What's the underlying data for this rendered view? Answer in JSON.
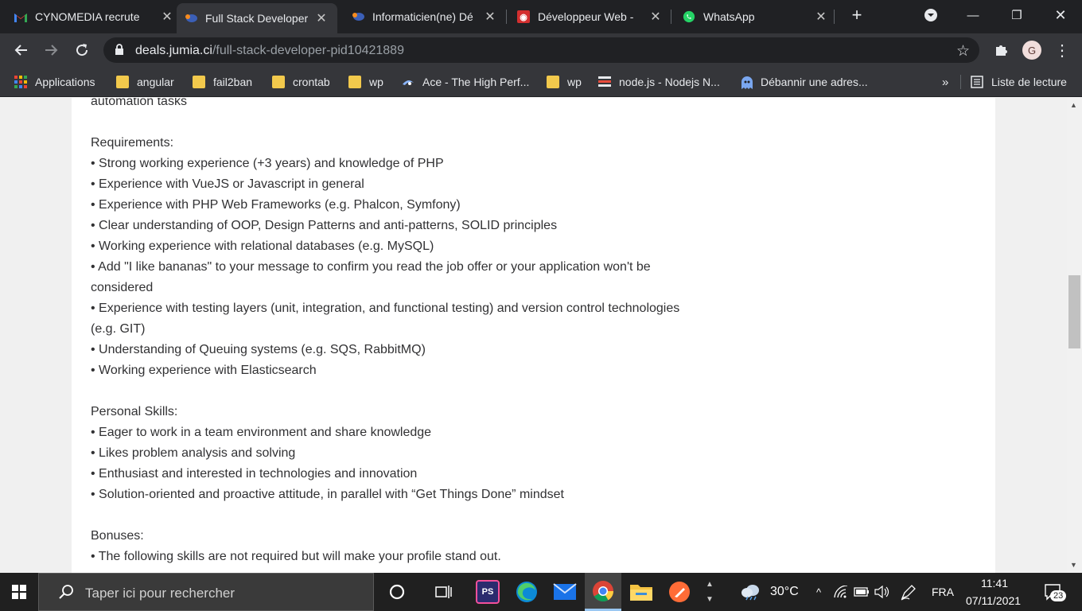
{
  "tabs": [
    {
      "title": "CYNOMEDIA recrute",
      "icon": "gmail-icon"
    },
    {
      "title": "Full Stack Developer",
      "icon": "jumia-icon"
    },
    {
      "title": "Informaticien(ne) Dé",
      "icon": "jumia-icon"
    },
    {
      "title": "Développeur Web - ",
      "icon": "emploi-icon"
    },
    {
      "title": "WhatsApp",
      "icon": "whatsapp-icon"
    }
  ],
  "address": {
    "host": "deals.jumia.ci",
    "path": "/full-stack-developer-pid10421889"
  },
  "profile_initial": "G",
  "bookmarks": [
    {
      "label": "Applications",
      "icon": "apps-grid-icon"
    },
    {
      "label": "angular",
      "icon": "folder-icon"
    },
    {
      "label": "fail2ban",
      "icon": "folder-icon"
    },
    {
      "label": "crontab",
      "icon": "folder-icon"
    },
    {
      "label": "wp",
      "icon": "folder-icon"
    },
    {
      "label": "Ace - The High Perf...",
      "icon": "ace-icon"
    },
    {
      "label": "wp",
      "icon": "folder-icon"
    },
    {
      "label": "node.js - Nodejs N...",
      "icon": "stackoverflow-icon"
    },
    {
      "label": "Débannir une adres...",
      "icon": "ghost-icon"
    }
  ],
  "bookmarks_overflow": "»",
  "reading_list": "Liste de lecture",
  "content": {
    "line_top": "automation tasks",
    "requirements_heading": "Requirements:",
    "requirements": [
      "• Strong working experience (+3 years) and knowledge of PHP",
      "• Experience with VueJS or Javascript in general",
      "• Experience with PHP Web Frameworks (e.g. Phalcon, Symfony)",
      "• Clear understanding of OOP, Design Patterns and anti-patterns, SOLID principles",
      "• Working experience with relational databases (e.g. MySQL)",
      "• Add \"I like bananas\" to your message to confirm you read the job offer or your application won't be considered",
      "• Experience with testing layers (unit, integration, and functional testing) and version control technologies (e.g. GIT)",
      "• Understanding of Queuing systems (e.g. SQS, RabbitMQ)",
      "• Working experience with Elasticsearch"
    ],
    "personal_heading": "Personal Skills:",
    "personal": [
      "• Eager to work in a team environment and share knowledge",
      "• Likes problem analysis and solving",
      "• Enthusiast and interested in technologies and innovation",
      "• Solution-oriented and proactive attitude, in parallel with “Get Things Done” mindset"
    ],
    "bonuses_heading": "Bonuses:",
    "bonuses": [
      "• The following skills are not required but will make your profile stand out."
    ]
  },
  "taskbar": {
    "search_placeholder": "Taper ici pour rechercher",
    "weather": "30°C",
    "language": "FRA",
    "time": "11:41",
    "date": "07/11/2021",
    "notifications": "23"
  }
}
